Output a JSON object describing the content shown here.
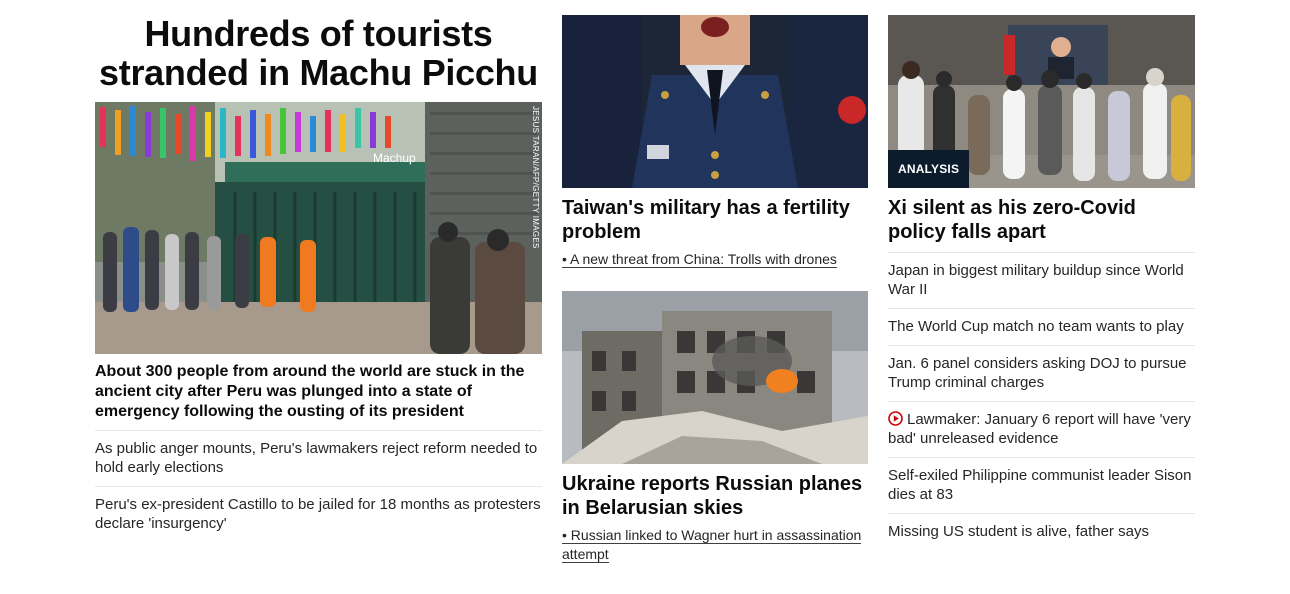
{
  "lead_story": {
    "headline": "Hundreds of tourists stranded in Machu Picchu",
    "image_credit": "JESUS TARAN/AFP/GETTY IMAGES",
    "image_sign": "Machup",
    "summary": "About 300 people from around the world are stuck in the ancient city after Peru was plunged into a state of emergency following the ousting of its president",
    "related": [
      "As public anger mounts, Peru's lawmakers reject reform needed to hold early elections",
      "Peru's ex-president Castillo to be jailed for 18 months as protesters declare 'insurgency'"
    ]
  },
  "middle": {
    "card1": {
      "headline": "Taiwan's military has a fertility problem",
      "sub_link": "• A new threat from China: Trolls with drones"
    },
    "card2": {
      "headline": "Ukraine reports Russian planes in Belarusian skies",
      "sub_link": "• Russian linked to Wagner hurt in assassination attempt"
    }
  },
  "right": {
    "badge": "ANALYSIS",
    "headline": "Xi silent as his zero-Covid policy falls apart",
    "links": [
      "Japan in biggest military buildup since World War II",
      "The World Cup match no team wants to play",
      "Jan. 6 panel considers asking DOJ to pursue Trump criminal charges",
      "Lawmaker: January 6 report will have 'very bad' unreleased evidence",
      "Self-exiled Philippine communist leader Sison dies at 83",
      "Missing US student is alive, father says"
    ],
    "video_icon": "play-circle-icon"
  },
  "colors": {
    "text": "#0c0c0c",
    "divider": "#e6e6e6",
    "badge_bg": "#0c1c2c",
    "video_red": "#cc0000"
  }
}
